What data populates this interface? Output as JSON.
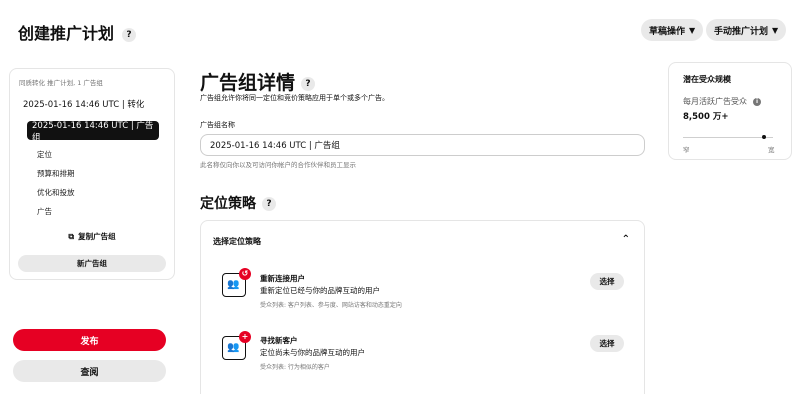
{
  "header": {
    "title": "创建推广计划",
    "draft_label": "草稿操作",
    "manual_label": "手动推广计划"
  },
  "sidebar": {
    "breadcrumb": "同质转化 推广计划, 1 广告组",
    "campaign_name": "2025-01-16 14:46 UTC | 转化",
    "ad_group_name": "2025-01-16 14:46 UTC | 广告组",
    "sub_items": [
      "定位",
      "预算和排期",
      "优化和投放",
      "广告"
    ],
    "duplicate_label": "复制广告组",
    "new_group_label": "新广告组",
    "publish_label": "发布",
    "review_label": "查阅"
  },
  "details": {
    "title": "广告组详情",
    "description": "广告组允许你将同一定位和竞价策略应用于单个或多个广告。",
    "name_label": "广告组名称",
    "name_value": "2025-01-16 14:46 UTC | 广告组",
    "name_hint": "此名称仅向你以及可访问你帐户的合作伙伴和员工显示"
  },
  "targeting": {
    "title": "定位策略",
    "card_title": "选择定位策略",
    "strategies": [
      {
        "title": "重新连接用户",
        "desc": "重新定位已经与你的品牌互动的用户",
        "list": "受众列表: 客户列表、参与度、网站访客和动态重定向",
        "button": "选择"
      },
      {
        "title": "寻找新客户",
        "desc": "定位尚未与你的品牌互动的用户",
        "list": "受众列表: 行为相似的客户",
        "button": "选择"
      }
    ]
  },
  "audience": {
    "title": "潜在受众规模",
    "monthly_label": "每月活跃广告受众",
    "value": "8,500 万+",
    "min_label": "窄",
    "max_label": "宽",
    "level": 0.9
  },
  "colors": {
    "accent": "#e60023",
    "neutral_button": "#e9e9e9",
    "selected_bg": "#111111"
  }
}
